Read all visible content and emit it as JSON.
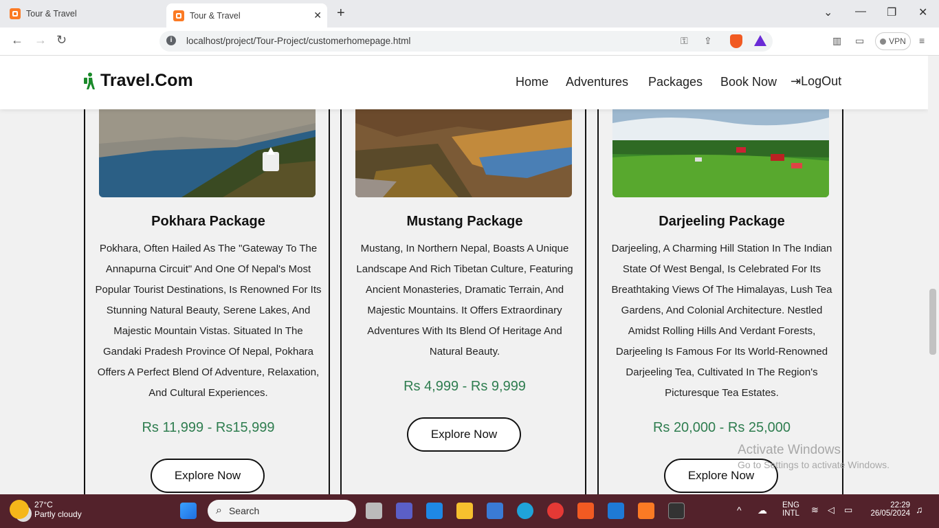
{
  "browser": {
    "tabs": [
      {
        "title": "Tour & Travel",
        "active": false
      },
      {
        "title": "Tour & Travel",
        "active": true
      }
    ],
    "url": "localhost/project/Tour-Project/customerhomepage.html",
    "vpn_label": "VPN"
  },
  "site": {
    "logo_text": "Travel.Com",
    "nav": [
      "Home",
      "Adventures",
      "Packages",
      "Book Now",
      "LogOut"
    ]
  },
  "packages": [
    {
      "title": "Pokhara Package",
      "description": "Pokhara, Often Hailed As The \"Gateway To The Annapurna Circuit\" And One Of Nepal's Most Popular Tourist Destinations, Is Renowned For Its Stunning Natural Beauty, Serene Lakes, And Majestic Mountain Vistas. Situated In The Gandaki Pradesh Province Of Nepal, Pokhara Offers A Perfect Blend Of Adventure, Relaxation, And Cultural Experiences.",
      "price": "Rs 11,999 - Rs15,999",
      "button": "Explore Now"
    },
    {
      "title": "Mustang Package",
      "description": "Mustang, In Northern Nepal, Boasts A Unique Landscape And Rich Tibetan Culture, Featuring Ancient Monasteries, Dramatic Terrain, And Majestic Mountains. It Offers Extraordinary Adventures With Its Blend Of Heritage And Natural Beauty.",
      "price": "Rs 4,999 - Rs 9,999",
      "button": "Explore Now"
    },
    {
      "title": "Darjeeling Package",
      "description": "Darjeeling, A Charming Hill Station In The Indian State Of West Bengal, Is Celebrated For Its Breathtaking Views Of The Himalayas, Lush Tea Gardens, And Colonial Architecture. Nestled Amidst Rolling Hills And Verdant Forests, Darjeeling Is Famous For Its World-Renowned Darjeeling Tea, Cultivated In The Region's Picturesque Tea Estates.",
      "price": "Rs 20,000 - Rs 25,000",
      "button": "Explore Now"
    }
  ],
  "watermark": {
    "title": "Activate Windows",
    "subtitle": "Go to Settings to activate Windows."
  },
  "taskbar": {
    "temp": "27°C",
    "weather": "Partly cloudy",
    "search_placeholder": "Search",
    "lang1": "ENG",
    "lang2": "INTL",
    "time": "22:29",
    "date": "26/05/2024"
  },
  "colors": {
    "price": "#2e7d4f",
    "taskbar": "#53222b",
    "accent_orange": "#fb7a24"
  }
}
